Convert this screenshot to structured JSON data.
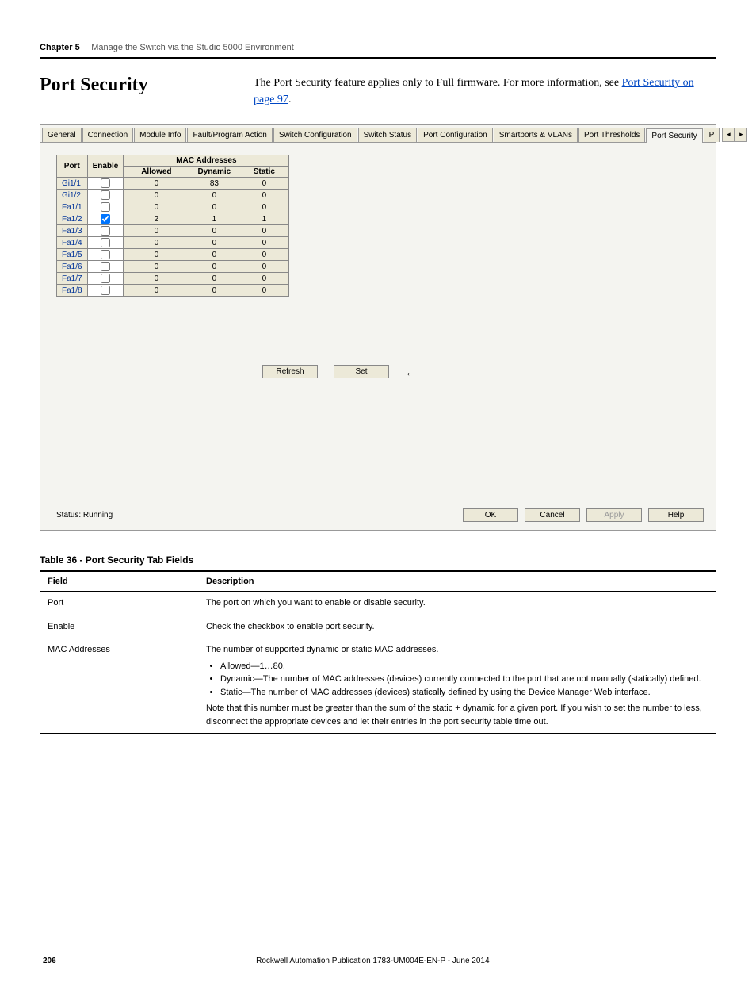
{
  "header": {
    "chapter": "Chapter 5",
    "subtitle": "Manage the Switch via the Studio 5000 Environment"
  },
  "intro": {
    "title": "Port Security",
    "body_pre": "The Port Security feature applies only to Full firmware. For more information, see ",
    "link_text": "Port Security on page 97",
    "body_post": "."
  },
  "dialog": {
    "tabs": [
      "General",
      "Connection",
      "Module Info",
      "Fault/Program Action",
      "Switch Configuration",
      "Switch Status",
      "Port Configuration",
      "Smartports & VLANs",
      "Port Thresholds",
      "Port Security",
      "P"
    ],
    "active_tab": "Port Security",
    "table_headers": {
      "port": "Port",
      "enable": "Enable",
      "mac_group": "MAC Addresses",
      "allowed": "Allowed",
      "dynamic": "Dynamic",
      "static": "Static"
    },
    "rows": [
      {
        "port": "Gi1/1",
        "enable": false,
        "allowed": "0",
        "dynamic": "83",
        "static": "0"
      },
      {
        "port": "Gi1/2",
        "enable": false,
        "allowed": "0",
        "dynamic": "0",
        "static": "0"
      },
      {
        "port": "Fa1/1",
        "enable": false,
        "allowed": "0",
        "dynamic": "0",
        "static": "0"
      },
      {
        "port": "Fa1/2",
        "enable": true,
        "allowed": "2",
        "dynamic": "1",
        "static": "1"
      },
      {
        "port": "Fa1/3",
        "enable": false,
        "allowed": "0",
        "dynamic": "0",
        "static": "0"
      },
      {
        "port": "Fa1/4",
        "enable": false,
        "allowed": "0",
        "dynamic": "0",
        "static": "0"
      },
      {
        "port": "Fa1/5",
        "enable": false,
        "allowed": "0",
        "dynamic": "0",
        "static": "0"
      },
      {
        "port": "Fa1/6",
        "enable": false,
        "allowed": "0",
        "dynamic": "0",
        "static": "0"
      },
      {
        "port": "Fa1/7",
        "enable": false,
        "allowed": "0",
        "dynamic": "0",
        "static": "0"
      },
      {
        "port": "Fa1/8",
        "enable": false,
        "allowed": "0",
        "dynamic": "0",
        "static": "0"
      }
    ],
    "buttons": {
      "refresh": "Refresh",
      "set": "Set",
      "arrow": "←"
    },
    "status": "Status: Running",
    "footer_buttons": {
      "ok": "OK",
      "cancel": "Cancel",
      "apply": "Apply",
      "help": "Help"
    }
  },
  "desc_table": {
    "caption": "Table 36 - Port Security Tab Fields",
    "headers": {
      "field": "Field",
      "desc": "Description"
    },
    "rows": [
      {
        "field": "Port",
        "desc": "The port on which you want to enable or disable security."
      },
      {
        "field": "Enable",
        "desc": "Check the checkbox to enable port security."
      },
      {
        "field": "MAC Addresses",
        "desc_intro": "The number of supported dynamic or static MAC addresses.",
        "bullets": [
          "Allowed—1…80.",
          "Dynamic—The number of MAC addresses (devices) currently connected to the port that are not manually (statically) defined.",
          "Static—The number of MAC addresses (devices) statically defined by using the Device Manager Web interface."
        ],
        "note": "Note that this number must be greater than the sum of the static + dynamic for a given port. If you wish to set the number to less, disconnect the appropriate devices and let their entries in the port security table time out."
      }
    ]
  },
  "footer": {
    "page": "206",
    "pub": "Rockwell Automation Publication 1783-UM004E-EN-P - June 2014"
  }
}
